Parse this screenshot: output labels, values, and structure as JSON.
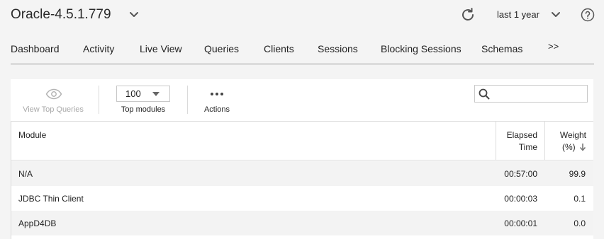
{
  "header": {
    "db_name": "Oracle-4.5.1.779",
    "time_range": "last 1 year",
    "icons": {
      "db_menu": "chevron-down-icon",
      "refresh": "refresh-icon",
      "range_menu": "chevron-down-icon",
      "help": "help-icon"
    }
  },
  "tabs": [
    {
      "label": "Dashboard"
    },
    {
      "label": "Activity"
    },
    {
      "label": "Live View"
    },
    {
      "label": "Queries"
    },
    {
      "label": "Clients"
    },
    {
      "label": "Sessions"
    },
    {
      "label": "Blocking Sessions"
    },
    {
      "label": "Schemas"
    },
    {
      "label": ">>"
    }
  ],
  "toolbar": {
    "view_top_queries": {
      "label": "View Top Queries",
      "icon": "eye-icon",
      "enabled": false
    },
    "top_modules": {
      "value": "100",
      "label": "Top modules"
    },
    "actions": {
      "label": "Actions",
      "icon": "more-icon"
    },
    "search": {
      "placeholder": "",
      "value": "",
      "icon": "search-icon"
    }
  },
  "table": {
    "columns": {
      "module": "Module",
      "elapsed_line1": "Elapsed",
      "elapsed_line2": "Time",
      "weight_line1": "Weight",
      "weight_line2": "(%)"
    },
    "sort": {
      "column": "weight",
      "direction": "descending",
      "icon": "arrow-down-icon"
    },
    "rows": [
      {
        "module": "N/A",
        "elapsed": "00:57:00",
        "weight": "99.9"
      },
      {
        "module": "JDBC Thin Client",
        "elapsed": "00:00:03",
        "weight": "0.1"
      },
      {
        "module": "AppD4DB",
        "elapsed": "00:00:01",
        "weight": "0.0"
      }
    ]
  },
  "colors": {
    "page_bg": "#f4f4f4",
    "panel_bg": "#ffffff",
    "row_alt": "#f3f3f3",
    "border": "#dcdcdc",
    "disabled_text": "#a9a9a9",
    "icon": "#555555"
  }
}
